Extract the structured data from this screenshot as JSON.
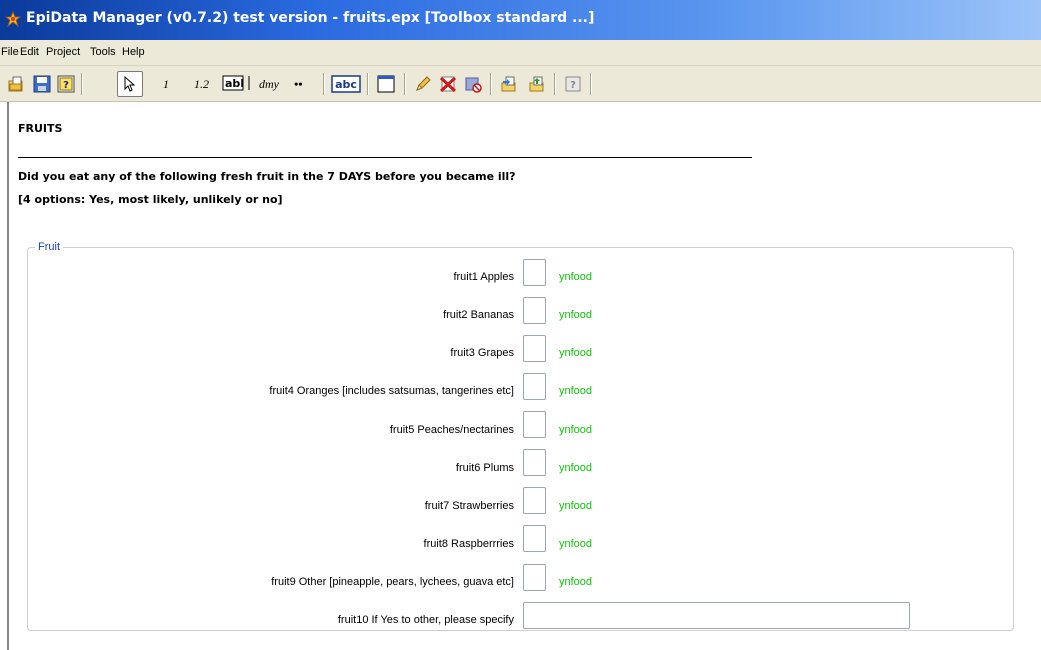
{
  "window": {
    "title": "EpiData Manager (v0.7.2) test version - fruits.epx [Toolbox standard ...]"
  },
  "menu": {
    "items": [
      "File",
      "Edit",
      "Project",
      "Tools",
      "Help"
    ]
  },
  "toolbar": {
    "integer_label": "1",
    "float_label": "1.2",
    "date_label": "dmy",
    "other_label": "••",
    "abc_label": "abc",
    "abI_label": "abI"
  },
  "form": {
    "heading": "FRUITS",
    "question": "Did you eat any of the following fresh fruit in the 7 DAYS before you became ill?",
    "options_note": "[4 options: Yes, most likely, unlikely or no]",
    "group_label": "Fruit",
    "fields": [
      {
        "label": "fruit1  Apples",
        "valuelabel": "ynfood"
      },
      {
        "label": "fruit2  Bananas",
        "valuelabel": "ynfood"
      },
      {
        "label": "fruit3  Grapes",
        "valuelabel": "ynfood"
      },
      {
        "label": "fruit4  Oranges [includes satsumas, tangerines etc]",
        "valuelabel": "ynfood"
      },
      {
        "label": "fruit5  Peaches/nectarines",
        "valuelabel": "ynfood"
      },
      {
        "label": "fruit6  Plums",
        "valuelabel": "ynfood"
      },
      {
        "label": "fruit7  Strawberries",
        "valuelabel": "ynfood"
      },
      {
        "label": "fruit8  Raspberrries",
        "valuelabel": "ynfood"
      },
      {
        "label": "fruit9  Other [pineapple, pears, lychees, guava etc]",
        "valuelabel": "ynfood"
      }
    ],
    "text_field": {
      "label": "fruit10  If Yes to other, please specify"
    }
  },
  "colors": {
    "valuelabel": "#12c00e",
    "group_label": "#1e3fa8",
    "titlebar": "#2a6ae0"
  },
  "icons": [
    "app-icon",
    "new-project-icon",
    "save-icon",
    "help-icon",
    "pointer-icon",
    "text-field-icon",
    "label-icon",
    "section-icon",
    "edit-pencil-icon",
    "delete-icon",
    "delete-all-icon",
    "import-icon",
    "export-icon",
    "info-icon"
  ]
}
